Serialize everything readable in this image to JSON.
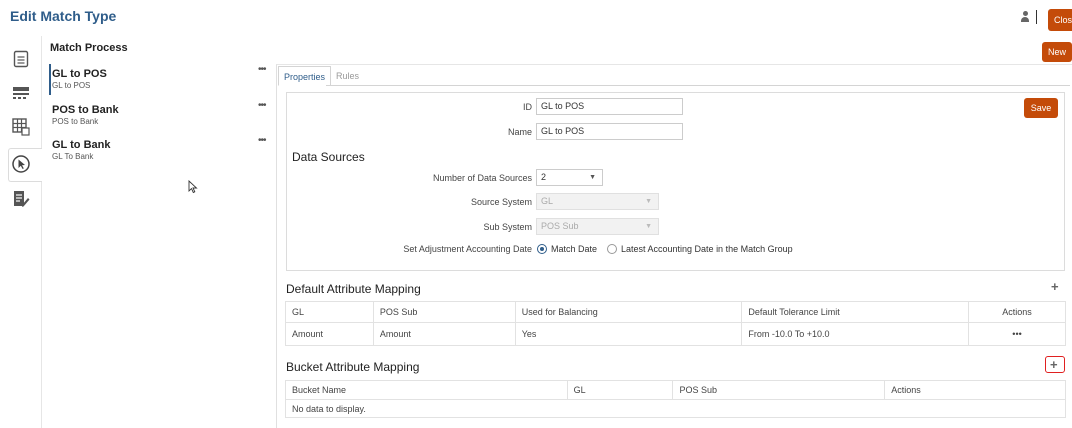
{
  "header": {
    "title": "Edit Match Type",
    "close_label": "Clos",
    "new_label": "New"
  },
  "rail": {
    "icons": [
      "document-list-icon",
      "list-panel-icon",
      "grid-icon",
      "pointer-target-icon",
      "edit-list-icon"
    ]
  },
  "match_process": {
    "title": "Match Process",
    "items": [
      {
        "name": "GL to POS",
        "sub": "GL to POS",
        "more": "•••"
      },
      {
        "name": "POS to Bank",
        "sub": "POS to Bank",
        "more": "•••"
      },
      {
        "name": "GL to Bank",
        "sub": "GL To Bank",
        "more": "•••"
      }
    ]
  },
  "tabs": [
    {
      "label": "Properties",
      "active": true
    },
    {
      "label": "Rules",
      "active": false
    }
  ],
  "properties": {
    "save_label": "Save",
    "id_label": "ID",
    "id_value": "GL to POS",
    "name_label": "Name",
    "name_value": "GL to POS"
  },
  "data_sources": {
    "title": "Data Sources",
    "num_label": "Number of Data Sources",
    "num_value": "2",
    "source_system_label": "Source System",
    "source_system_value": "GL",
    "sub_system_label": "Sub System",
    "sub_system_value": "POS Sub",
    "adj_date_label": "Set Adjustment Accounting Date",
    "option_match_date": "Match Date",
    "option_latest_date": "Latest Accounting Date in the Match Group"
  },
  "default_attr": {
    "title": "Default Attribute Mapping",
    "headers": [
      "GL",
      "POS Sub",
      "Used for Balancing",
      "Default Tolerance Limit",
      "Actions"
    ],
    "rows": [
      [
        "Amount",
        "Amount",
        "Yes",
        "From -10.0 To +10.0",
        "•••"
      ]
    ]
  },
  "bucket_attr": {
    "title": "Bucket Attribute Mapping",
    "headers": [
      "Bucket Name",
      "GL",
      "POS Sub",
      "Actions"
    ],
    "empty": "No data to display."
  },
  "colors": {
    "accent": "#2f5d8a",
    "button": "#c44b09",
    "highlight": "#e02020"
  }
}
